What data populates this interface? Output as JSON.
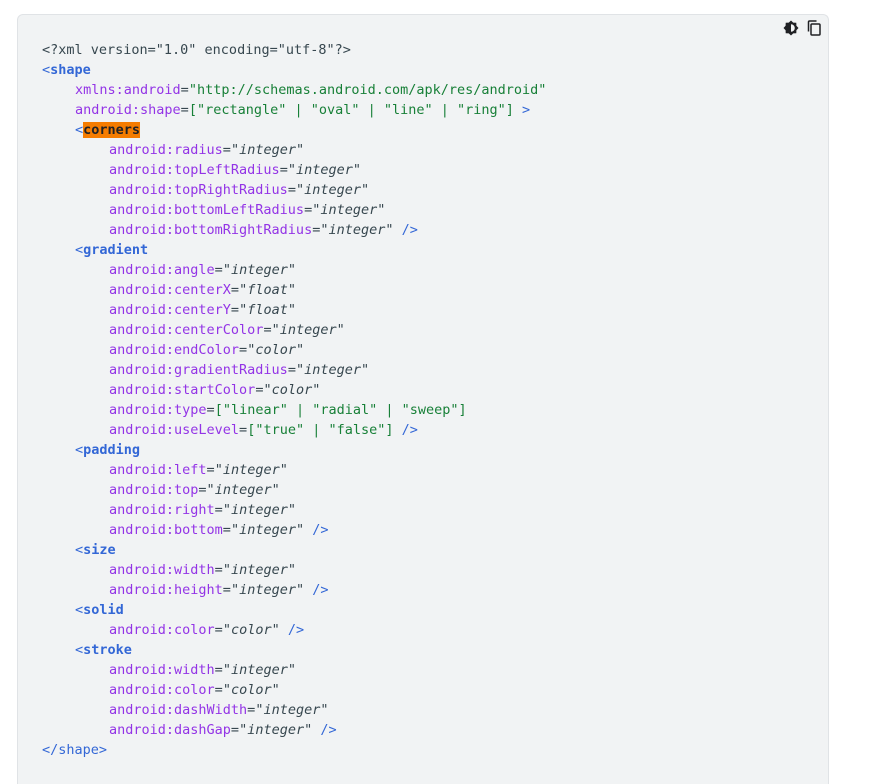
{
  "toolbar": {
    "theme_icon": "dark-mode-toggle-icon",
    "copy_icon": "copy-icon"
  },
  "code": {
    "prolog": "<?xml version=\"1.0\" encoding=\"utf-8\"?>",
    "shape_open": "shape",
    "shape_xmlns_attr": "xmlns:android",
    "shape_xmlns_val": "\"http://schemas.android.com/apk/res/android\"",
    "shape_shape_attr": "android:shape",
    "shape_shape_val": "[\"rectangle\" | \"oval\" | \"line\" | \"ring\"]",
    "corners": "corners",
    "gradient": "gradient",
    "padding": "padding",
    "size": "size",
    "solid": "solid",
    "stroke": "stroke",
    "shape_close": "</shape>",
    "corners_attrs": [
      {
        "name": "android:radius",
        "value": "integer"
      },
      {
        "name": "android:topLeftRadius",
        "value": "integer"
      },
      {
        "name": "android:topRightRadius",
        "value": "integer"
      },
      {
        "name": "android:bottomLeftRadius",
        "value": "integer"
      },
      {
        "name": "android:bottomRightRadius",
        "value": "integer"
      }
    ],
    "gradient_attrs": [
      {
        "name": "android:angle",
        "value": "integer"
      },
      {
        "name": "android:centerX",
        "value": "float"
      },
      {
        "name": "android:centerY",
        "value": "float"
      },
      {
        "name": "android:centerColor",
        "value": "integer"
      },
      {
        "name": "android:endColor",
        "value": "color"
      },
      {
        "name": "android:gradientRadius",
        "value": "integer"
      },
      {
        "name": "android:startColor",
        "value": "color"
      },
      {
        "name": "android:type",
        "raw": "[\"linear\" | \"radial\" | \"sweep\"]"
      },
      {
        "name": "android:useLevel",
        "raw": "[\"true\" | \"false\"]"
      }
    ],
    "padding_attrs": [
      {
        "name": "android:left",
        "value": "integer"
      },
      {
        "name": "android:top",
        "value": "integer"
      },
      {
        "name": "android:right",
        "value": "integer"
      },
      {
        "name": "android:bottom",
        "value": "integer"
      }
    ],
    "size_attrs": [
      {
        "name": "android:width",
        "value": "integer"
      },
      {
        "name": "android:height",
        "value": "integer"
      }
    ],
    "solid_attrs": [
      {
        "name": "android:color",
        "value": "color"
      }
    ],
    "stroke_attrs": [
      {
        "name": "android:width",
        "value": "integer"
      },
      {
        "name": "android:color",
        "value": "color"
      },
      {
        "name": "android:dashWidth",
        "value": "integer"
      },
      {
        "name": "android:dashGap",
        "value": "integer"
      }
    ]
  },
  "colors": {
    "panel_bg": "#f1f3f4",
    "tag": "#3367d6",
    "attr": "#9334e6",
    "string": "#188038",
    "highlight": "#f57c00"
  }
}
